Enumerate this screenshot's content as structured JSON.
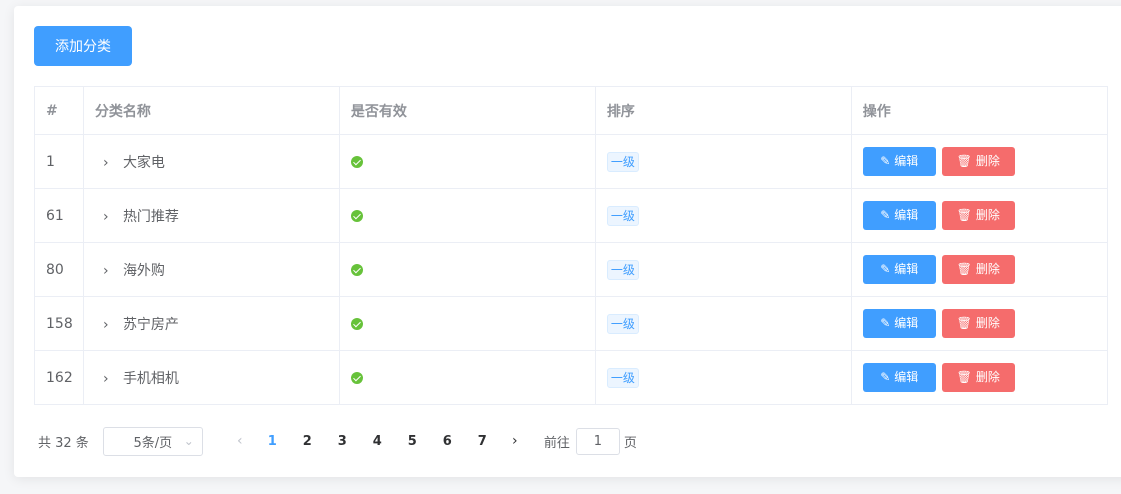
{
  "toolbar": {
    "add_label": "添加分类"
  },
  "table": {
    "headers": {
      "idx": "#",
      "name": "分类名称",
      "valid": "是否有效",
      "sort": "排序",
      "op": "操作"
    },
    "edit_label": "编辑",
    "delete_label": "删除",
    "rows": [
      {
        "idx": "1",
        "name": "大家电",
        "level": "一级"
      },
      {
        "idx": "61",
        "name": "热门推荐",
        "level": "一级"
      },
      {
        "idx": "80",
        "name": "海外购",
        "level": "一级"
      },
      {
        "idx": "158",
        "name": "苏宁房产",
        "level": "一级"
      },
      {
        "idx": "162",
        "name": "手机相机",
        "level": "一级"
      }
    ]
  },
  "pagination": {
    "total": "共 32 条",
    "page_size": "5条/页",
    "pages": [
      "1",
      "2",
      "3",
      "4",
      "5",
      "6",
      "7"
    ],
    "current": "1",
    "goto_label": "前往",
    "goto_value": "1",
    "page_suffix": "页"
  },
  "colors": {
    "primary": "#409eff",
    "danger": "#f56c6c",
    "success": "#67c23a"
  }
}
